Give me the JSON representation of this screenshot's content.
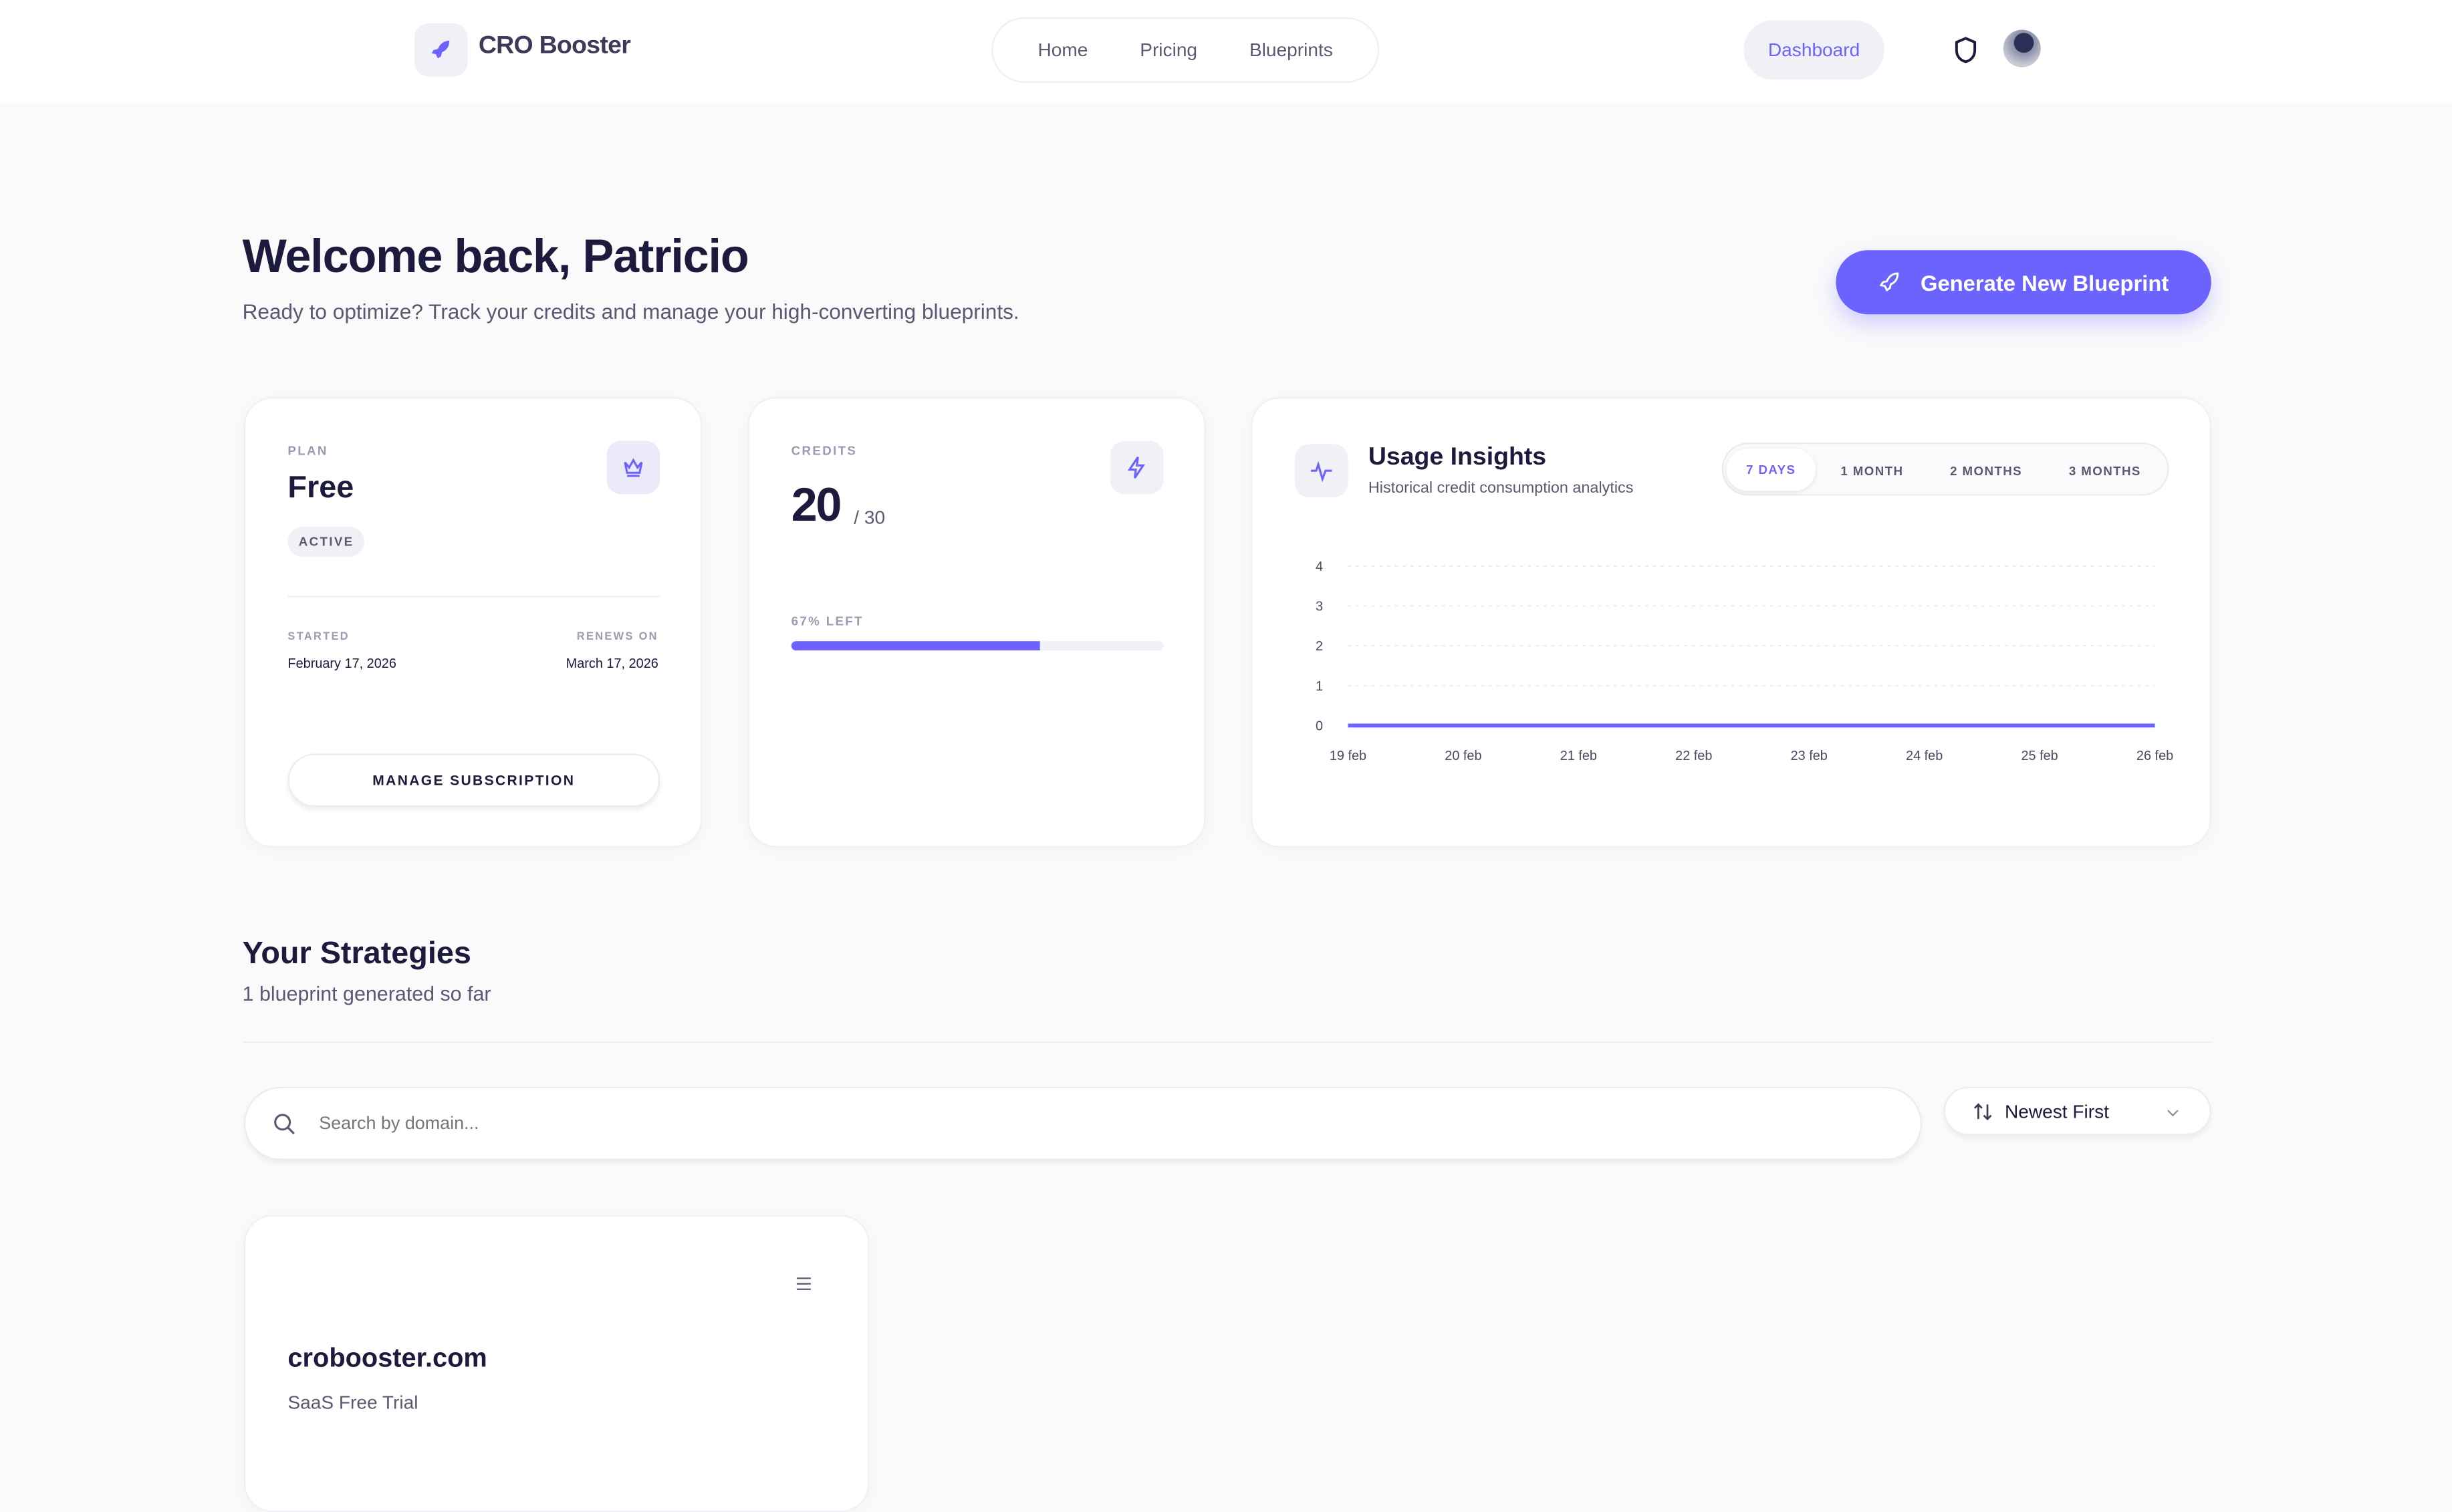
{
  "brand": {
    "name": "CRO Booster",
    "icon": "rocket-icon"
  },
  "nav": {
    "items": [
      "Home",
      "Pricing",
      "Blueprints"
    ],
    "dashboard": "Dashboard"
  },
  "colors": {
    "accent": "#6c63ff",
    "text": "#1c1a3d",
    "background": "#fafafb"
  },
  "header": {
    "title": "Welcome back, Patricio",
    "subtitle": "Ready to optimize? Track your credits and manage your high-converting blueprints.",
    "cta": "Generate New Blueprint"
  },
  "plan": {
    "label": "PLAN",
    "name": "Free",
    "status": "ACTIVE",
    "started_label": "STARTED",
    "started": "February 17, 2026",
    "renews_label": "RENEWS ON",
    "renews": "March 17, 2026",
    "manage": "MANAGE SUBSCRIPTION"
  },
  "credits": {
    "label": "CREDITS",
    "value": "20",
    "total": "/ 30",
    "left_label": "67% LEFT",
    "fraction_left": 0.67
  },
  "usage": {
    "title": "Usage Insights",
    "subtitle": "Historical credit consumption analytics",
    "tabs": [
      "7 DAYS",
      "1 MONTH",
      "2 MONTHS",
      "3 MONTHS"
    ],
    "active_tab": "7 DAYS"
  },
  "chart_data": {
    "type": "line",
    "x": [
      "19 feb",
      "20 feb",
      "21 feb",
      "22 feb",
      "23 feb",
      "24 feb",
      "25 feb",
      "26 feb"
    ],
    "values": [
      0,
      0,
      0,
      0,
      0,
      0,
      0,
      0
    ],
    "ylim": [
      0,
      4
    ],
    "yticks": [
      "0",
      "1",
      "2",
      "3",
      "4"
    ],
    "grid": true,
    "title": "",
    "xlabel": "",
    "ylabel": ""
  },
  "strategies": {
    "title": "Your Strategies",
    "count_text": "1 blueprint generated so far",
    "search_placeholder": "Search by domain...",
    "sort": "Newest First",
    "items": [
      {
        "domain": "crobooster.com",
        "type": "SaaS Free Trial"
      }
    ]
  }
}
